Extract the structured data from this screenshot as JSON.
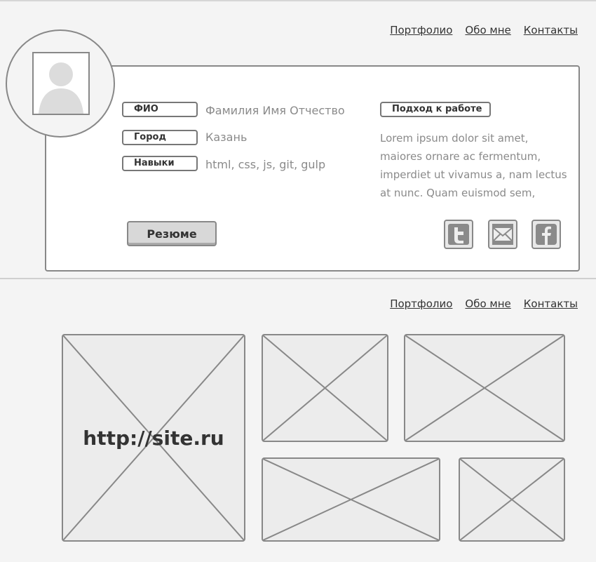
{
  "nav_top": {
    "items": [
      "Портфолио",
      "Обо мне",
      "Контакты"
    ]
  },
  "profile": {
    "fields": [
      {
        "label": "ФИО",
        "value": "Фамилия Имя Отчество"
      },
      {
        "label": "Город",
        "value": "Казань"
      },
      {
        "label": "Навыки",
        "value": "html, css, js, git, gulp"
      }
    ],
    "approach": {
      "label": "Подход к работе",
      "text": "Lorem ipsum dolor sit amet, maiores ornare ac fermentum, imperdiet ut vivamus a, nam lectus at nunc. Quam euismod sem,"
    },
    "resume_button": "Резюме",
    "social_icons": [
      "twitter-icon",
      "mail-icon",
      "facebook-icon"
    ]
  },
  "nav_bottom": {
    "items": [
      "Портфолио",
      "Обо мне",
      "Контакты"
    ]
  },
  "portfolio": {
    "site_url": "http://site.ru"
  }
}
